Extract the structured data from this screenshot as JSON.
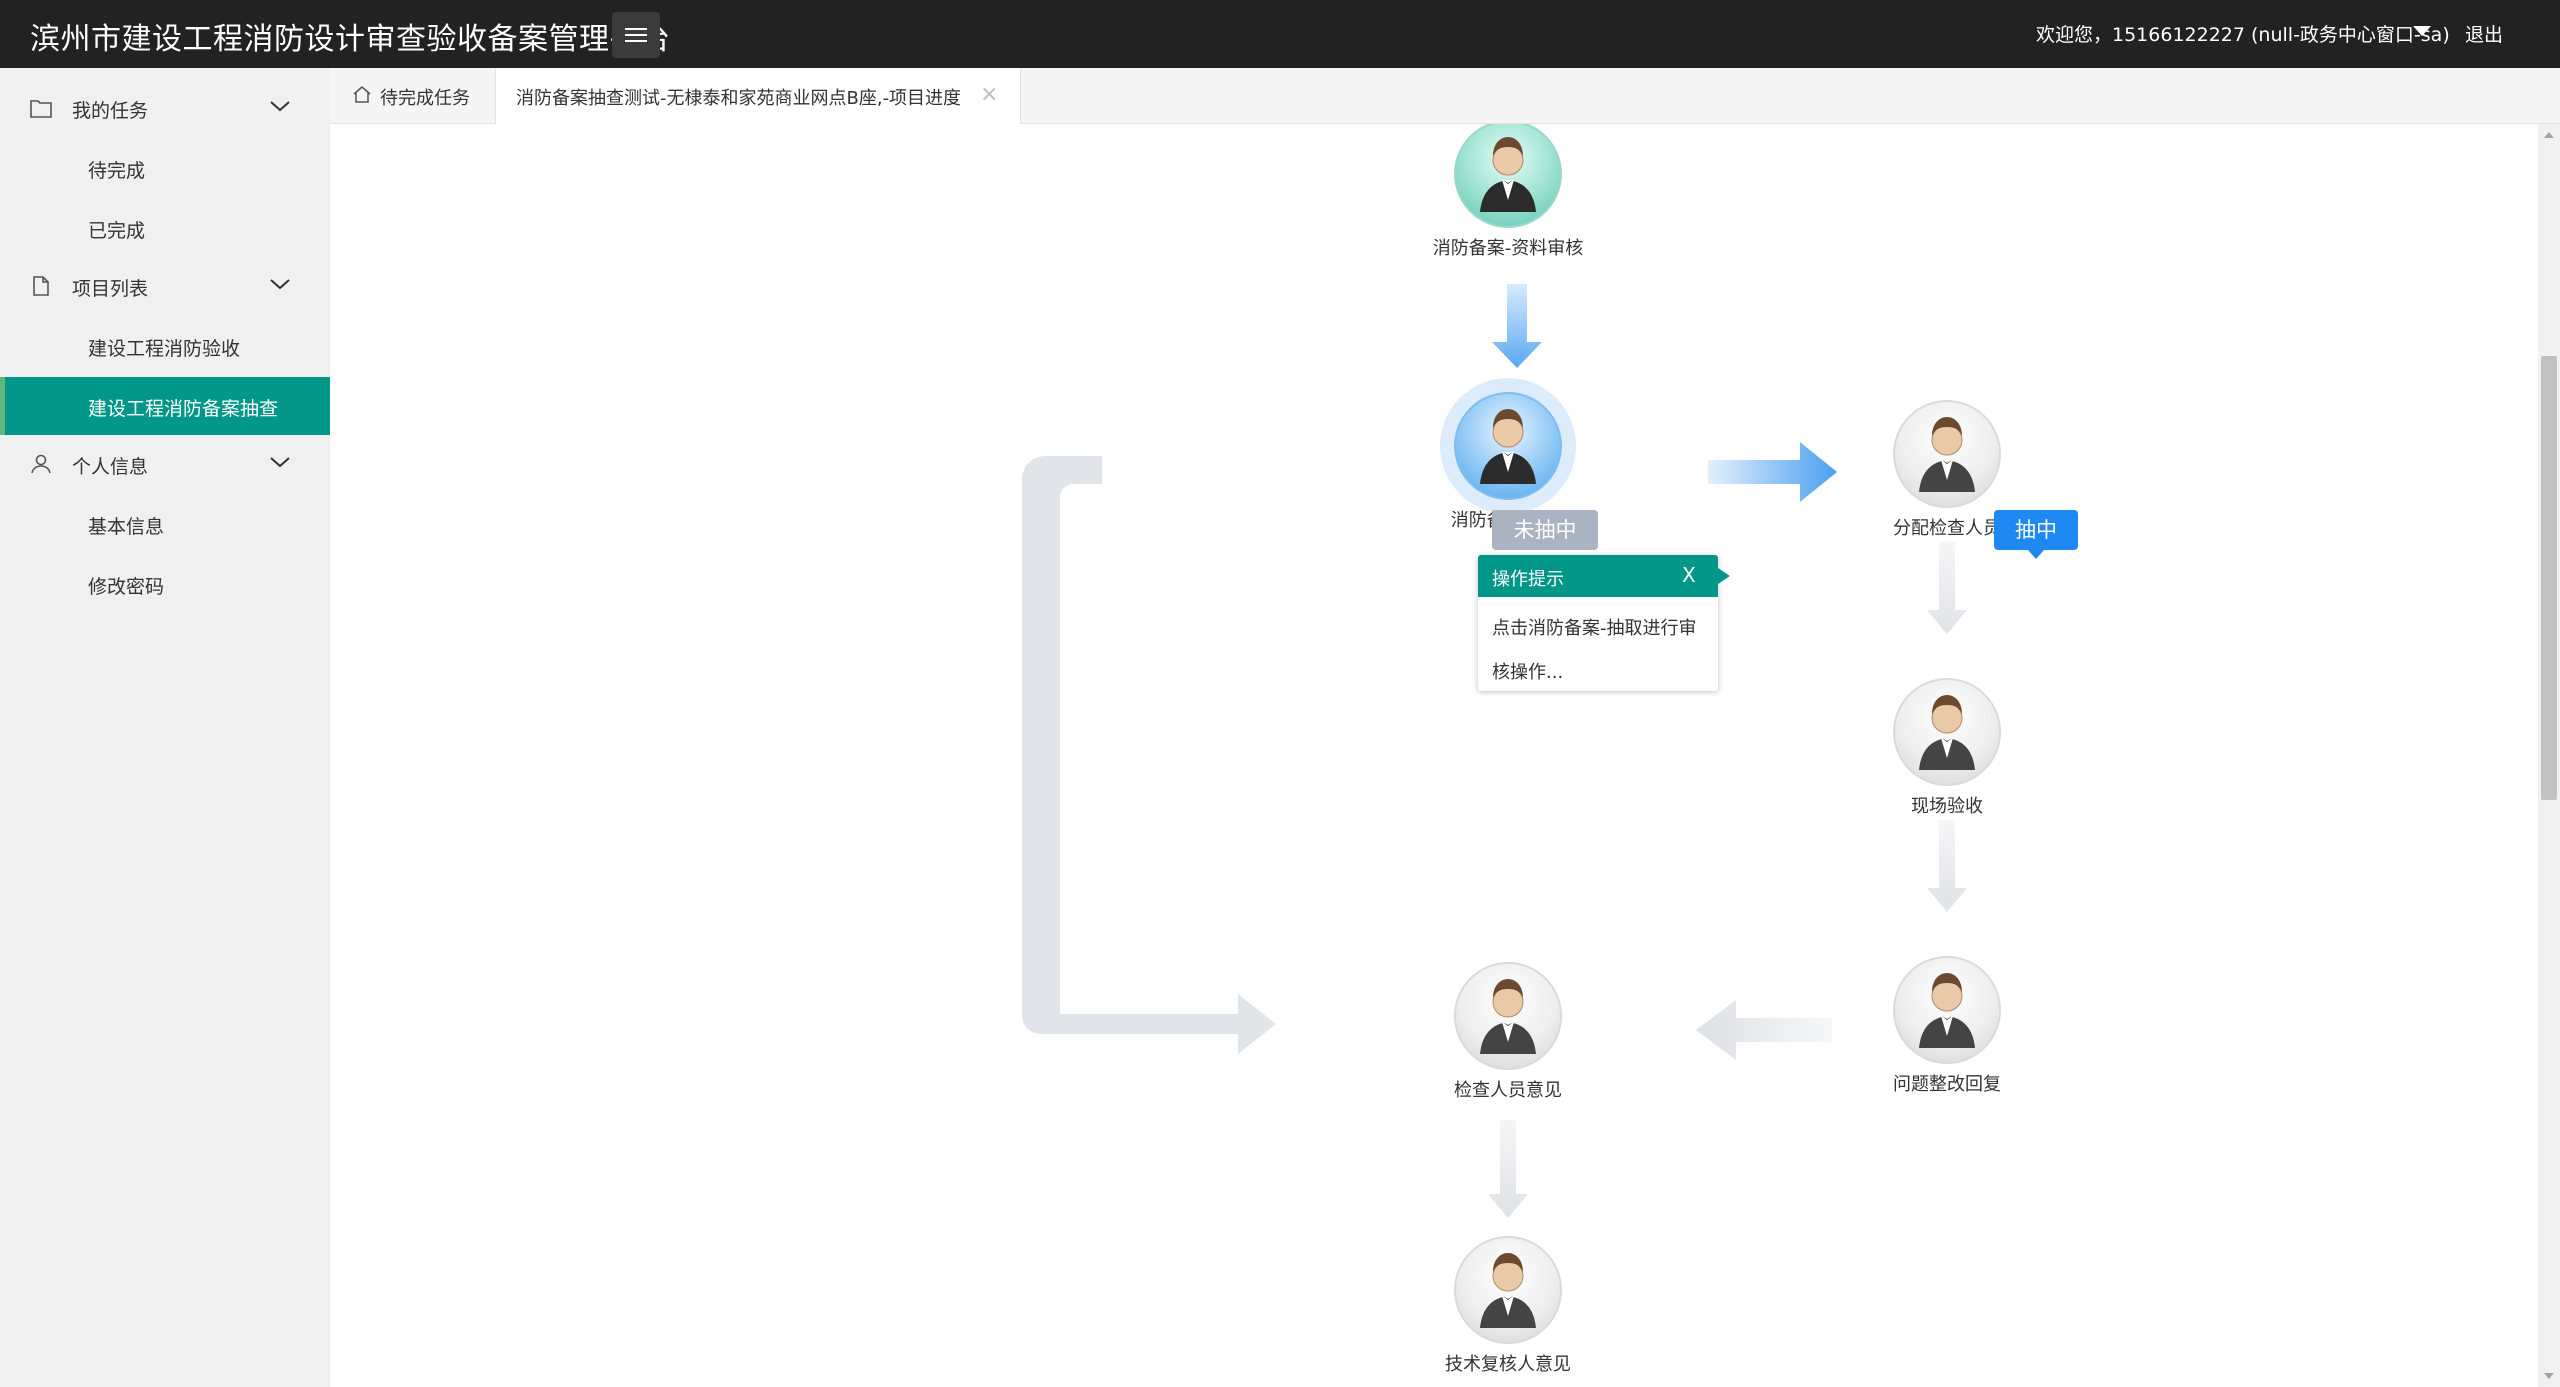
{
  "header": {
    "title": "滨州市建设工程消防设计审查验收备案管理平台",
    "welcome": "欢迎您，15166122227 (null-政务中心窗口-sa)",
    "logout": "退出"
  },
  "sidebar": {
    "groups": [
      {
        "label": "我的任务",
        "icon": "folder-icon",
        "items": [
          {
            "label": "待完成"
          },
          {
            "label": "已完成"
          }
        ]
      },
      {
        "label": "项目列表",
        "icon": "file-icon",
        "items": [
          {
            "label": "建设工程消防验收"
          },
          {
            "label": "建设工程消防备案抽查",
            "active": true
          }
        ]
      },
      {
        "label": "个人信息",
        "icon": "user-icon",
        "items": [
          {
            "label": "基本信息"
          },
          {
            "label": "修改密码"
          }
        ]
      }
    ],
    "active_color": "#009688"
  },
  "tabs": [
    {
      "label": "待完成任务",
      "icon": "home-icon"
    },
    {
      "label": "消防备案抽查测试-无棣泰和家苑商业网点B座,-项目进度",
      "active": true
    }
  ],
  "flow": {
    "nodes": [
      {
        "label": "消防备案-资料审核",
        "state": "done"
      },
      {
        "label": "消防备案-抽取",
        "state": "current"
      },
      {
        "label": "分配检查人员",
        "state": "pending"
      },
      {
        "label": "现场验收",
        "state": "pending"
      },
      {
        "label": "问题整改回复",
        "state": "pending"
      },
      {
        "label": "检查人员意见",
        "state": "pending"
      },
      {
        "label": "技术复核人意见",
        "state": "pending"
      }
    ],
    "branch_not_selected": "未抽中",
    "branch_selected": "抽中",
    "tooltip": {
      "title": "操作提示",
      "close": "X",
      "line1": "点击消防备案-抽取进行审",
      "line2": "核操作..."
    }
  }
}
